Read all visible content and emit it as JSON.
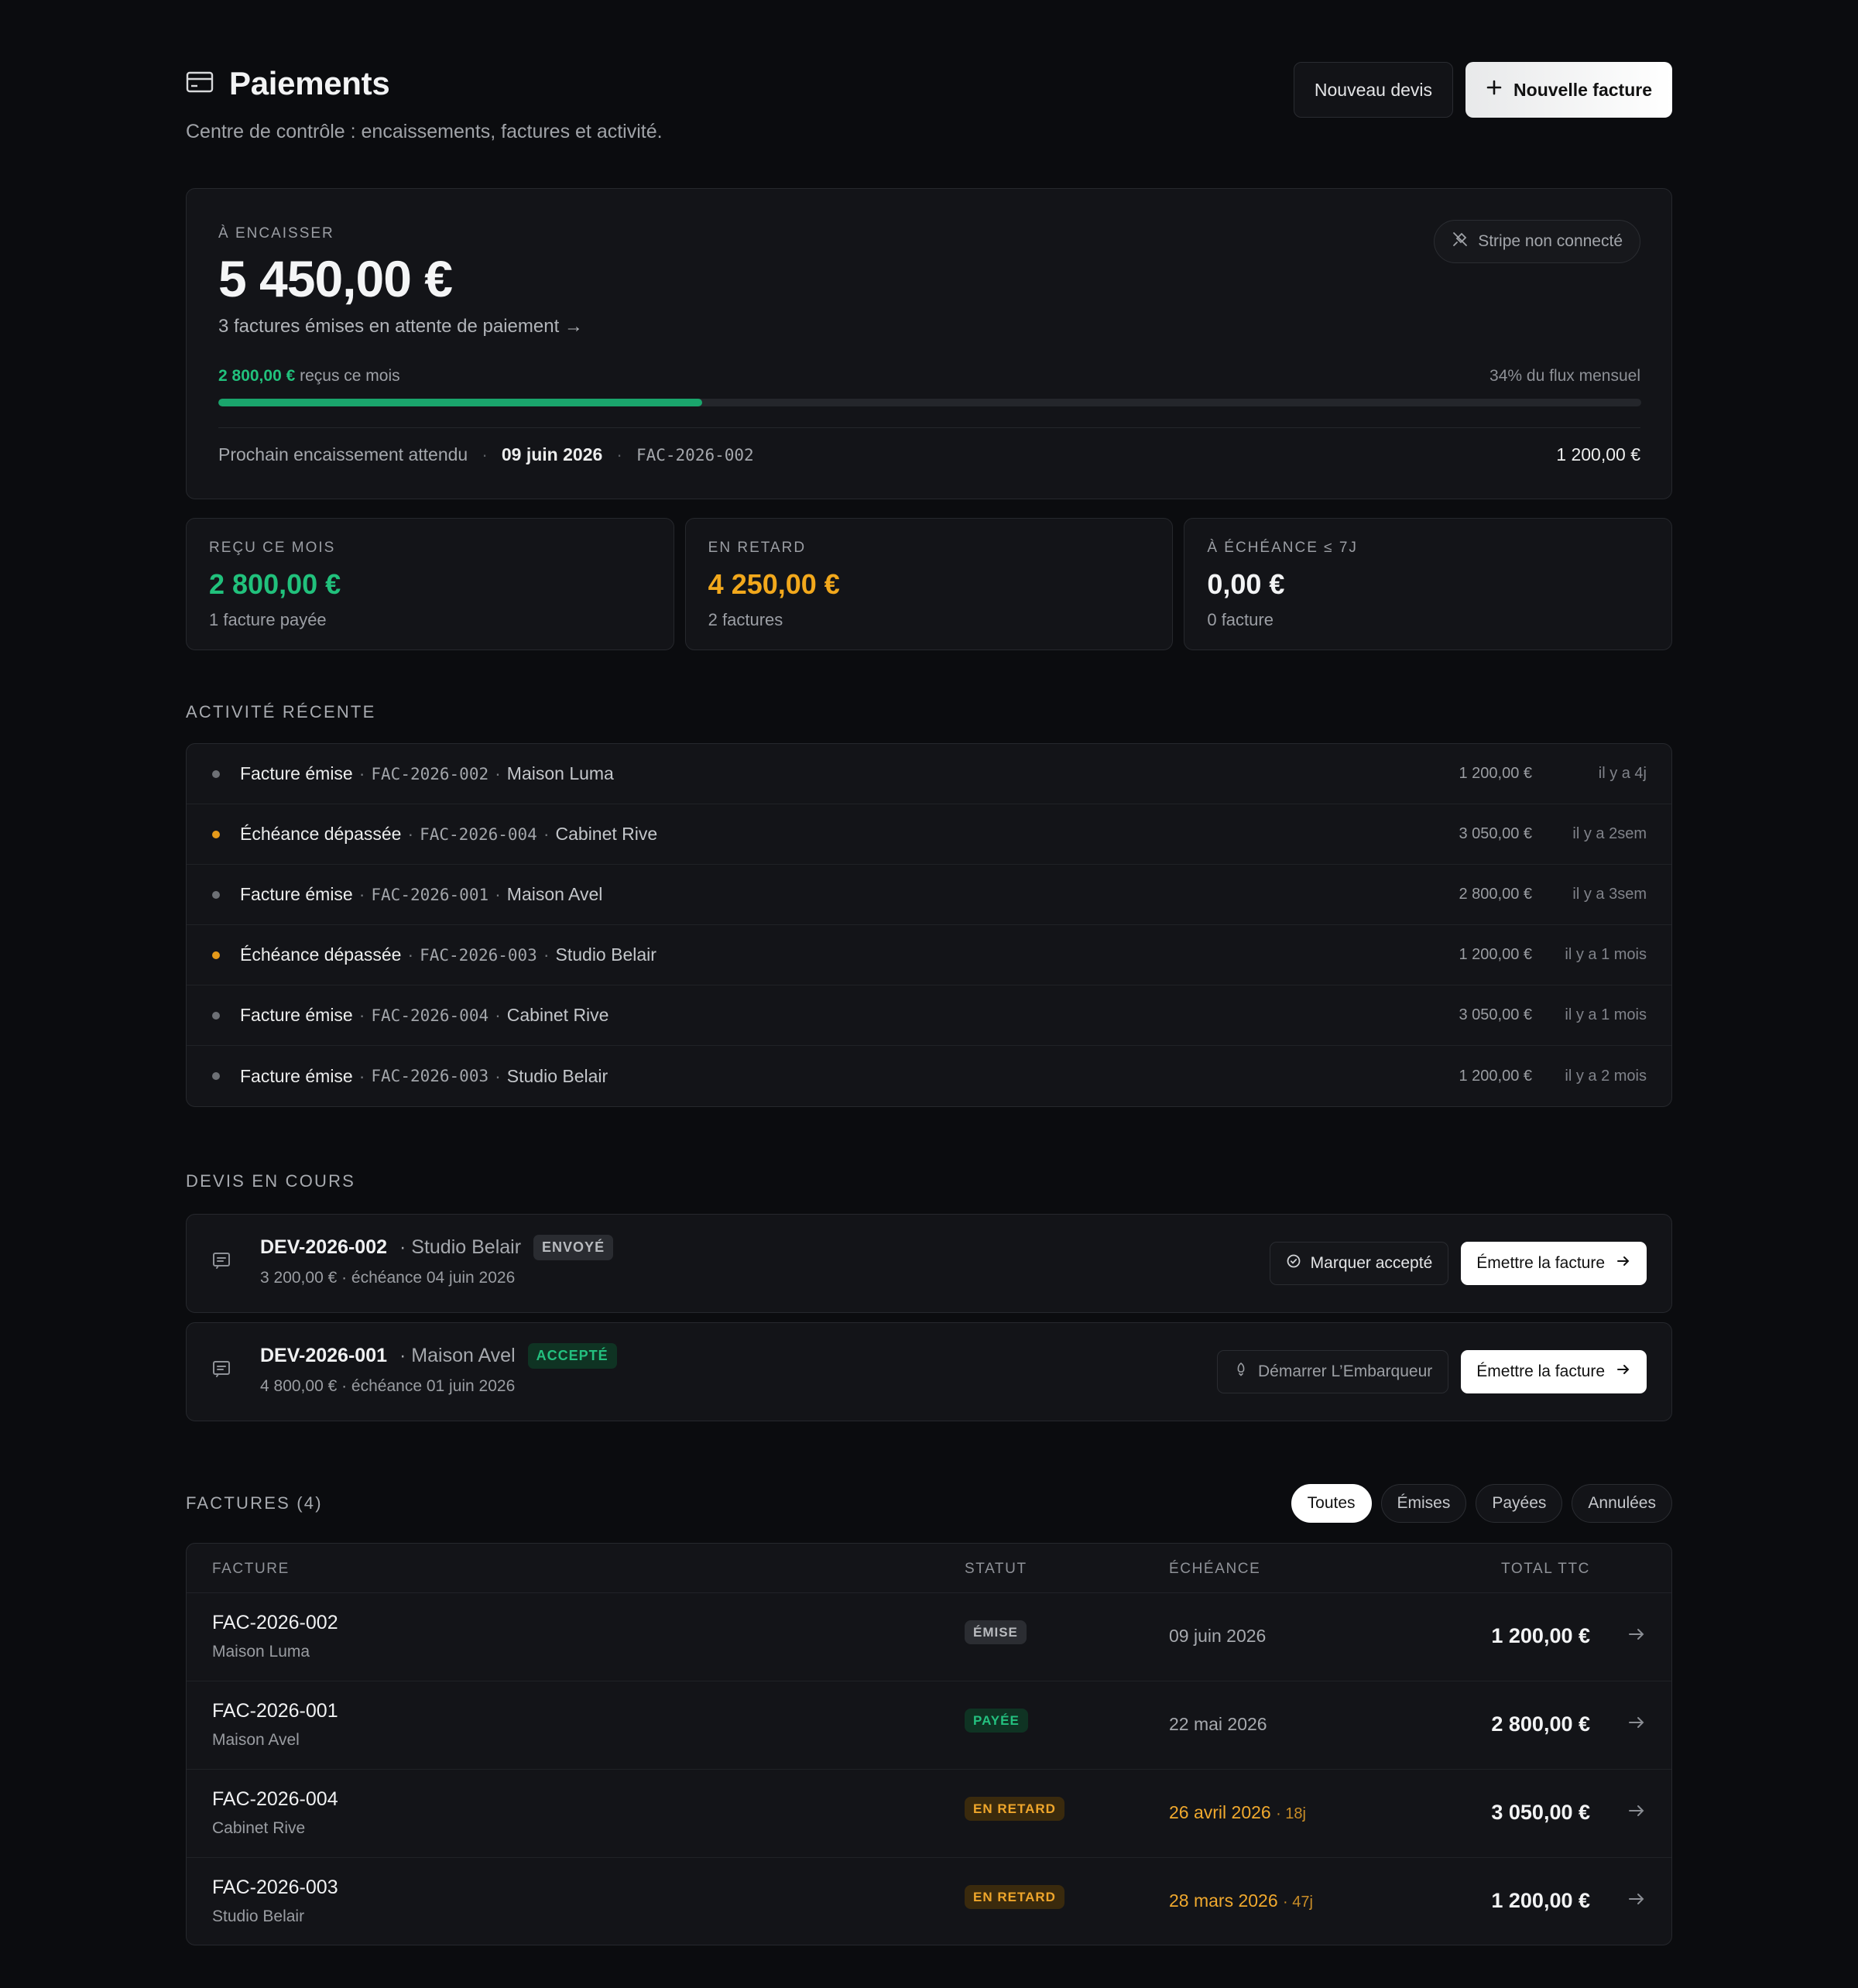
{
  "header": {
    "title": "Paiements",
    "subtitle": "Centre de contrôle : encaissements, factures et activité.",
    "btn_devis": "Nouveau devis",
    "btn_facture": "Nouvelle facture"
  },
  "hero": {
    "eyebrow": "À ENCAISSER",
    "amount": "5 450,00 €",
    "pending": "3 factures émises en attente de paiement →",
    "stripe": "Stripe non connecté",
    "received_amount": "2 800,00 €",
    "received_label": "reçus ce mois",
    "flux": "34% du flux mensuel",
    "progress": 0.34,
    "next_label": "Prochain encaissement attendu",
    "next_date": "09 juin 2026",
    "next_code": "FAC-2026-002",
    "next_amount": "1 200,00 €"
  },
  "stats": [
    {
      "label": "REÇU CE MOIS",
      "value": "2 800,00 €",
      "sub": "1 facture payée",
      "color": "#21c17c"
    },
    {
      "label": "EN RETARD",
      "value": "4 250,00 €",
      "sub": "2 factures",
      "color": "#f2a81c"
    },
    {
      "label": "À ÉCHÉANCE ≤ 7J",
      "value": "0,00 €",
      "sub": "0 facture",
      "color": "#f2f3f4"
    }
  ],
  "activity": {
    "label": "ACTIVITÉ RÉCENTE",
    "items": [
      {
        "event": "Facture émise",
        "code": "FAC-2026-002",
        "client": "Maison Luma",
        "amount": "1 200,00 €",
        "time": "il y a 4j",
        "warn": false
      },
      {
        "event": "Échéance dépassée",
        "code": "FAC-2026-004",
        "client": "Cabinet Rive",
        "amount": "3 050,00 €",
        "time": "il y a 2sem",
        "warn": true
      },
      {
        "event": "Facture émise",
        "code": "FAC-2026-001",
        "client": "Maison Avel",
        "amount": "2 800,00 €",
        "time": "il y a 3sem",
        "warn": false
      },
      {
        "event": "Échéance dépassée",
        "code": "FAC-2026-003",
        "client": "Studio Belair",
        "amount": "1 200,00 €",
        "time": "il y a 1 mois",
        "warn": true
      },
      {
        "event": "Facture émise",
        "code": "FAC-2026-004",
        "client": "Cabinet Rive",
        "amount": "3 050,00 €",
        "time": "il y a 1 mois",
        "warn": false
      },
      {
        "event": "Facture émise",
        "code": "FAC-2026-003",
        "client": "Studio Belair",
        "amount": "1 200,00 €",
        "time": "il y a 2 mois",
        "warn": false
      }
    ]
  },
  "devis": {
    "label": "DEVIS EN COURS",
    "items": [
      {
        "code": "DEV-2026-002",
        "client": "· Studio Belair",
        "badge": "ENVOYÉ",
        "sub": "3 200,00 € · échéance 04 juin 2026",
        "action": "Marquer accepté",
        "issue": "Émettre la facture"
      },
      {
        "code": "DEV-2026-001",
        "client": "· Maison Avel",
        "badge": "ACCEPTÉ",
        "sub": "4 800,00 € · échéance 01 juin 2026",
        "action": "Démarrer L’Embarqueur",
        "issue": "Émettre la facture"
      }
    ]
  },
  "factures": {
    "label": "FACTURES (4)",
    "filters": [
      "Toutes",
      "Émises",
      "Payées",
      "Annulées"
    ],
    "columns": {
      "facture": "FACTURE",
      "statut": "STATUT",
      "echeance": "ÉCHÉANCE",
      "total": "TOTAL TTC"
    },
    "rows": [
      {
        "code": "FAC-2026-002",
        "client": "Maison Luma",
        "status": "ÉMISE",
        "due": "09 juin 2026",
        "days": "",
        "total": "1 200,00 €"
      },
      {
        "code": "FAC-2026-001",
        "client": "Maison Avel",
        "status": "PAYÉE",
        "due": "22 mai 2026",
        "days": "",
        "total": "2 800,00 €"
      },
      {
        "code": "FAC-2026-004",
        "client": "Cabinet Rive",
        "status": "EN RETARD",
        "due": "26 avril 2026",
        "days": "· 18j",
        "total": "3 050,00 €"
      },
      {
        "code": "FAC-2026-003",
        "client": "Studio Belair",
        "status": "EN RETARD",
        "due": "28 mars 2026",
        "days": "· 47j",
        "total": "1 200,00 €"
      }
    ]
  }
}
